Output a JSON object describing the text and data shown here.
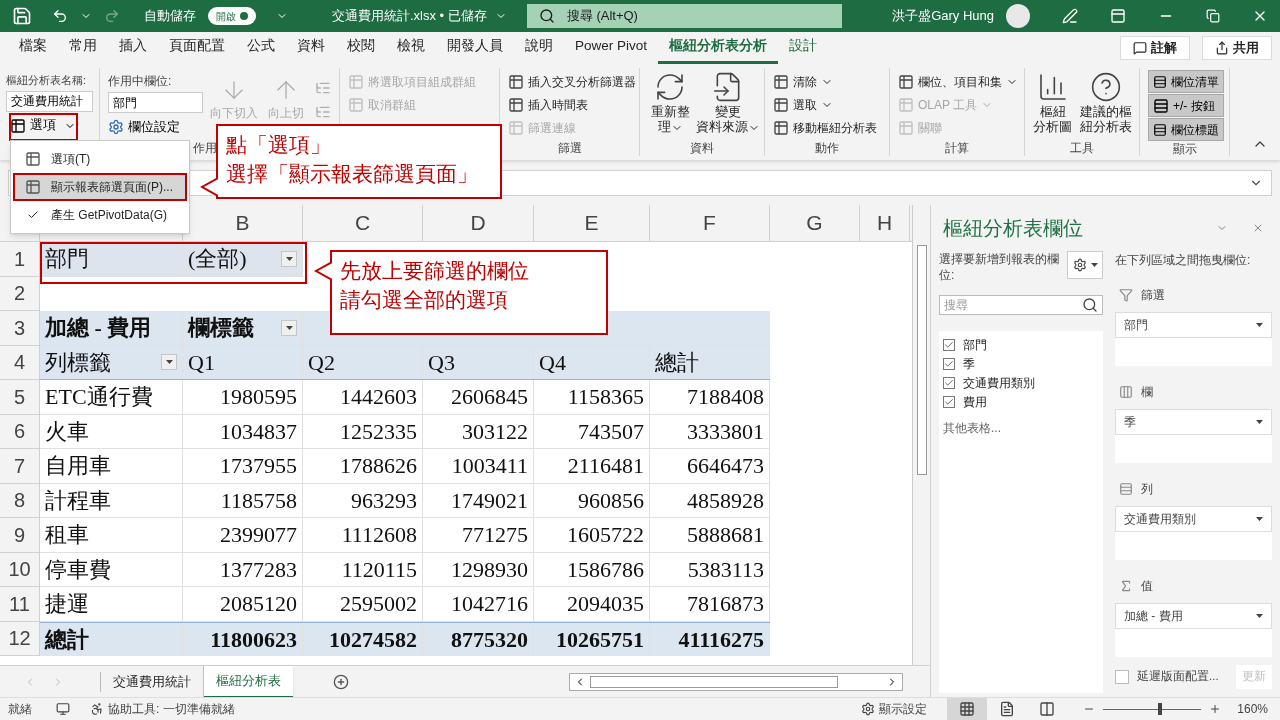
{
  "window": {
    "autosave_label": "自動儲存",
    "autosave": {
      "label": "開啟",
      "on": true
    },
    "title": "交通費用統計.xlsx • 已儲存",
    "search": {
      "placeholder": "搜尋 (Alt+Q)"
    },
    "user": "洪子盛Gary Hung"
  },
  "menu_tabs": [
    {
      "label": "檔案",
      "selected": false,
      "contextual": false
    },
    {
      "label": "常用",
      "selected": false,
      "contextual": false
    },
    {
      "label": "插入",
      "selected": false,
      "contextual": false
    },
    {
      "label": "頁面配置",
      "selected": false,
      "contextual": false
    },
    {
      "label": "公式",
      "selected": false,
      "contextual": false
    },
    {
      "label": "資料",
      "selected": false,
      "contextual": false
    },
    {
      "label": "校閱",
      "selected": false,
      "contextual": false
    },
    {
      "label": "檢視",
      "selected": false,
      "contextual": false
    },
    {
      "label": "開發人員",
      "selected": false,
      "contextual": false
    },
    {
      "label": "說明",
      "selected": false,
      "contextual": false
    },
    {
      "label": "Power Pivot",
      "selected": false,
      "contextual": false
    },
    {
      "label": "樞紐分析表分析",
      "selected": true,
      "contextual": true
    },
    {
      "label": "設計",
      "selected": false,
      "contextual": true
    }
  ],
  "comments_button": "註解",
  "share_button": "共用",
  "ribbon": [
    {
      "kind": "name",
      "label": "樞紐分析表名稱:",
      "value": "交通費用統計",
      "button": "選項"
    },
    {
      "kind": "active_field",
      "label": "作用中欄位:",
      "value": "部門",
      "button": "欄位設定",
      "group_label": "作用",
      "drill": [
        {
          "label": "向下切入",
          "disabled": true
        },
        {
          "label": "向上切",
          "disabled": true
        }
      ]
    },
    {
      "kind": "stack",
      "items": [
        {
          "label": "將選取項目組成群組",
          "disabled": true,
          "caret": false
        },
        {
          "label": "取消群組",
          "disabled": true,
          "caret": false
        }
      ]
    },
    {
      "kind": "stack",
      "group_label": "篩選",
      "items": [
        {
          "label": "插入交叉分析篩選器",
          "disabled": false,
          "caret": false
        },
        {
          "label": "插入時間表",
          "disabled": false,
          "caret": false
        },
        {
          "label": "篩選連線",
          "disabled": true,
          "caret": false
        }
      ]
    },
    {
      "kind": "big",
      "group_label": "資料",
      "items": [
        {
          "lines": [
            "重新整",
            "理"
          ],
          "caret": true
        },
        {
          "lines": [
            "變更",
            "資料來源"
          ],
          "caret": true
        }
      ]
    },
    {
      "kind": "stack",
      "group_label": "動作",
      "items": [
        {
          "label": "清除",
          "disabled": false,
          "caret": true
        },
        {
          "label": "選取",
          "disabled": false,
          "caret": true
        },
        {
          "label": "移動樞紐分析表",
          "disabled": false,
          "caret": false
        }
      ]
    },
    {
      "kind": "stack",
      "group_label": "計算",
      "items": [
        {
          "label": "欄位、項目和集",
          "disabled": false,
          "caret": true
        },
        {
          "label": "OLAP 工具",
          "disabled": true,
          "caret": true
        },
        {
          "label": "關聯",
          "disabled": true,
          "caret": false
        }
      ]
    },
    {
      "kind": "big",
      "group_label": "工具",
      "items": [
        {
          "lines": [
            "樞紐",
            "分析圖"
          ],
          "caret": false
        },
        {
          "lines": [
            "建議的樞",
            "紐分析表"
          ],
          "caret": false
        }
      ]
    },
    {
      "kind": "toggles",
      "group_label": "顯示",
      "items": [
        {
          "label": "欄位清單",
          "on": true
        },
        {
          "label": "+/- 按鈕",
          "on": true
        },
        {
          "label": "欄位標題",
          "on": true
        }
      ]
    }
  ],
  "options_menu": [
    {
      "label": "選項(T)",
      "selected": false,
      "checked": false
    },
    {
      "label": "顯示報表篩選頁面(P)...",
      "selected": true,
      "checked": false
    },
    {
      "label": "產生 GetPivotData(G)",
      "selected": false,
      "checked": true
    }
  ],
  "sheet": {
    "columns": [
      "",
      "B",
      "C",
      "D",
      "E",
      "F",
      "G",
      "H"
    ],
    "rows": [
      {
        "number": "1",
        "kind": "filter",
        "cells": [
          {
            "text": "部門",
            "dropdown": false
          },
          {
            "text": "(全部)",
            "dropdown": true
          }
        ]
      },
      {
        "number": "2",
        "kind": "blank",
        "cells": []
      },
      {
        "number": "3",
        "kind": "pivot_header",
        "cells": [
          {
            "text": "加總 - 費用",
            "dropdown": false
          },
          {
            "text": "欄標籤",
            "dropdown": true
          }
        ]
      },
      {
        "number": "4",
        "kind": "pivot_header",
        "cells": [
          {
            "text": "列標籤",
            "dropdown": true
          },
          {
            "text": "Q1",
            "dropdown": false
          },
          {
            "text": "Q2",
            "dropdown": false
          },
          {
            "text": "Q3",
            "dropdown": false
          },
          {
            "text": "Q4",
            "dropdown": false
          },
          {
            "text": "總計",
            "dropdown": false
          }
        ]
      },
      {
        "number": "5",
        "kind": "data",
        "cells": [
          {
            "text": "ETC通行費"
          },
          {
            "text": "1980595"
          },
          {
            "text": "1442603"
          },
          {
            "text": "2606845"
          },
          {
            "text": "1158365"
          },
          {
            "text": "7188408"
          }
        ]
      },
      {
        "number": "6",
        "kind": "data",
        "cells": [
          {
            "text": "火車"
          },
          {
            "text": "1034837"
          },
          {
            "text": "1252335"
          },
          {
            "text": "303122"
          },
          {
            "text": "743507"
          },
          {
            "text": "3333801"
          }
        ]
      },
      {
        "number": "7",
        "kind": "data",
        "cells": [
          {
            "text": "自用車"
          },
          {
            "text": "1737955"
          },
          {
            "text": "1788626"
          },
          {
            "text": "1003411"
          },
          {
            "text": "2116481"
          },
          {
            "text": "6646473"
          }
        ]
      },
      {
        "number": "8",
        "kind": "data",
        "cells": [
          {
            "text": "計程車"
          },
          {
            "text": "1185758"
          },
          {
            "text": "963293"
          },
          {
            "text": "1749021"
          },
          {
            "text": "960856"
          },
          {
            "text": "4858928"
          }
        ]
      },
      {
        "number": "9",
        "kind": "data",
        "cells": [
          {
            "text": "租車"
          },
          {
            "text": "2399077"
          },
          {
            "text": "1112608"
          },
          {
            "text": "771275"
          },
          {
            "text": "1605722"
          },
          {
            "text": "5888681"
          }
        ]
      },
      {
        "number": "10",
        "kind": "data",
        "cells": [
          {
            "text": "停車費"
          },
          {
            "text": "1377283"
          },
          {
            "text": "1120115"
          },
          {
            "text": "1298930"
          },
          {
            "text": "1586786"
          },
          {
            "text": "5383113"
          }
        ]
      },
      {
        "number": "11",
        "kind": "data",
        "cells": [
          {
            "text": "捷運"
          },
          {
            "text": "2085120"
          },
          {
            "text": "2595002"
          },
          {
            "text": "1042716"
          },
          {
            "text": "2094035"
          },
          {
            "text": "7816873"
          }
        ]
      },
      {
        "number": "12",
        "kind": "total",
        "cells": [
          {
            "text": "總計"
          },
          {
            "text": "11800623"
          },
          {
            "text": "10274582"
          },
          {
            "text": "8775320"
          },
          {
            "text": "10265751"
          },
          {
            "text": "41116275"
          }
        ]
      }
    ]
  },
  "field_pane": {
    "title": "樞紐分析表欄位",
    "choose_label": "選擇要新增到報表的欄位:",
    "search": {
      "placeholder": "搜尋"
    },
    "fields": [
      {
        "label": "部門",
        "checked": true
      },
      {
        "label": "季",
        "checked": true
      },
      {
        "label": "交通費用類別",
        "checked": true
      },
      {
        "label": "費用",
        "checked": true
      }
    ],
    "more_tables": "其他表格...",
    "areas_label": "在下列區域之間拖曳欄位:",
    "areas": [
      {
        "kind": "filters",
        "label": "篩選",
        "fields": [
          "部門"
        ]
      },
      {
        "kind": "columns",
        "label": "欄",
        "fields": [
          "季"
        ]
      },
      {
        "kind": "rows",
        "label": "列",
        "fields": [
          "交通費用類別"
        ]
      },
      {
        "kind": "values",
        "label": "值",
        "fields": [
          "加總 - 費用"
        ]
      }
    ],
    "defer": {
      "label": "延遲版面配置...",
      "checked": false
    },
    "update_button": {
      "label": "更新",
      "disabled": true
    }
  },
  "sheet_tabs": [
    {
      "label": "交通費用統計",
      "selected": false
    },
    {
      "label": "樞紐分析表",
      "selected": true
    }
  ],
  "status": {
    "ready": "就緒",
    "accessibility": "協助工具: 一切準備就緒",
    "display_settings": "顯示設定",
    "views": [
      {
        "kind": "normal",
        "selected": true
      },
      {
        "kind": "page_layout",
        "selected": false
      },
      {
        "kind": "page_break",
        "selected": false
      }
    ],
    "zoom": {
      "level": 0.58,
      "reading": "160%"
    }
  },
  "annotations": [
    {
      "kind": "callout",
      "lines": [
        "點「選項」",
        "選擇「顯示報表篩選頁面」"
      ]
    },
    {
      "kind": "callout",
      "lines": [
        "先放上要篩選的欄位",
        "請勾選全部的選項"
      ]
    }
  ]
}
